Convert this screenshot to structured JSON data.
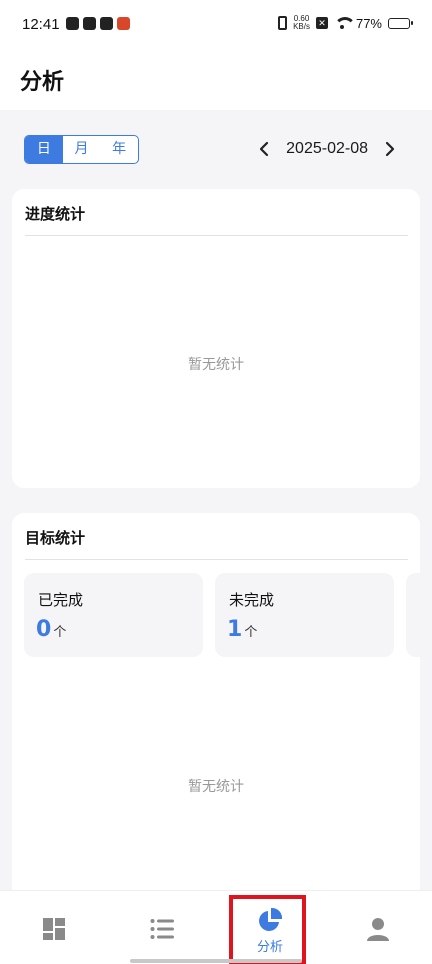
{
  "status_bar": {
    "time": "12:41",
    "net_speed_value": "0.60",
    "net_speed_unit": "KB/s",
    "battery_text": "77%",
    "battery_level": 0.77
  },
  "header": {
    "title": "分析"
  },
  "period_selector": {
    "options": [
      "日",
      "月",
      "年"
    ],
    "selected": "日",
    "accent_color": "#3d7be0"
  },
  "date_nav": {
    "date": "2025-02-08",
    "prev_icon": "chevron-left-icon",
    "next_icon": "chevron-right-icon"
  },
  "progress_card": {
    "title": "进度统计",
    "empty_text": "暂无统计"
  },
  "goal_card": {
    "title": "目标统计",
    "stats": [
      {
        "label": "已完成",
        "value": "0",
        "unit": "个"
      },
      {
        "label": "未完成",
        "value": "1",
        "unit": "个"
      }
    ],
    "empty_text": "暂无统计"
  },
  "bottom_nav": {
    "items": [
      {
        "icon": "dashboard-grid-icon",
        "label": ""
      },
      {
        "icon": "list-icon",
        "label": ""
      },
      {
        "icon": "pie-chart-icon",
        "label": "分析",
        "active": true
      },
      {
        "icon": "person-icon",
        "label": ""
      }
    ],
    "active_color": "#3d7be0",
    "inactive_color": "#8a8a8a",
    "highlight_color": "#e0141e"
  }
}
